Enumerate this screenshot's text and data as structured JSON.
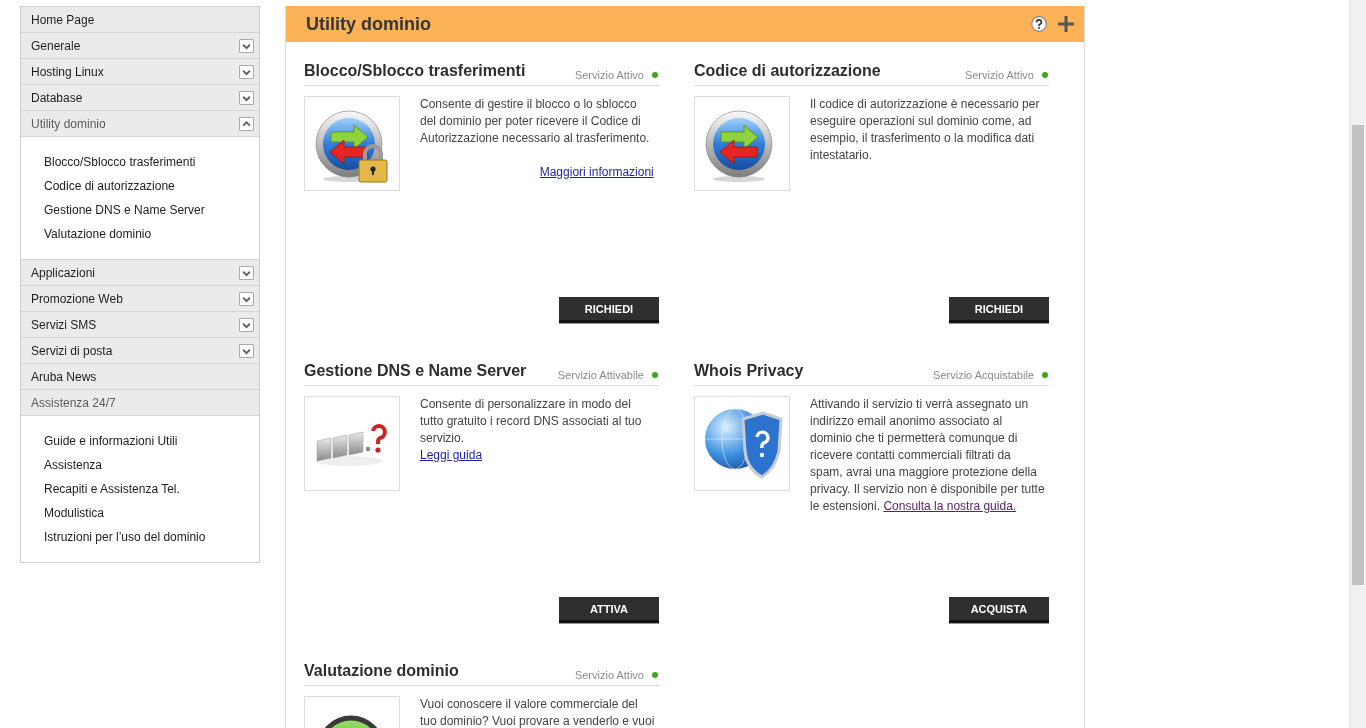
{
  "sidebar": {
    "items": [
      {
        "label": "Home Page",
        "kind": "link",
        "expanded": false
      },
      {
        "label": "Generale",
        "kind": "toggle",
        "expanded": false
      },
      {
        "label": "Hosting Linux",
        "kind": "toggle",
        "expanded": false
      },
      {
        "label": "Database",
        "kind": "toggle",
        "expanded": false
      },
      {
        "label": "Utility dominio",
        "kind": "toggle",
        "expanded": true,
        "children": [
          {
            "label": "Blocco/Sblocco trasferimenti"
          },
          {
            "label": "Codice di autorizzazione"
          },
          {
            "label": "Gestione DNS e Name Server"
          },
          {
            "label": "Valutazione dominio"
          }
        ]
      },
      {
        "label": "Applicazioni",
        "kind": "toggle",
        "expanded": false
      },
      {
        "label": "Promozione Web",
        "kind": "toggle",
        "expanded": false
      },
      {
        "label": "Servizi SMS",
        "kind": "toggle",
        "expanded": false
      },
      {
        "label": "Servizi di posta",
        "kind": "toggle",
        "expanded": false
      },
      {
        "label": "Aruba News",
        "kind": "link",
        "expanded": false
      },
      {
        "label": "Assistenza 24/7",
        "kind": "link",
        "expanded": true,
        "children": [
          {
            "label": "Guide e informazioni Utili"
          },
          {
            "label": "Assistenza"
          },
          {
            "label": "Recapiti e Assistenza Tel."
          },
          {
            "label": "Modulistica"
          },
          {
            "label": "Istruzioni per l’uso del dominio"
          }
        ]
      }
    ]
  },
  "panel": {
    "title": "Utility dominio",
    "cards": [
      {
        "title": "Blocco/Sblocco trasferimenti",
        "status": "Servizio Attivo",
        "description": "Consente di gestire il blocco o lo sblocco del dominio per poter ricevere il Codice di Autorizzazione necessario al trasferimento.",
        "link": {
          "text": "Maggiori informazioni",
          "kind": "more",
          "visited": false
        },
        "button": "RICHIEDI"
      },
      {
        "title": "Codice di autorizzazione",
        "status": "Servizio Attivo",
        "description": "Il codice di autorizzazione è necessario per eseguire operazioni sul dominio come, ad esempio, il trasferimento o la modifica dati intestatario.",
        "button": "RICHIEDI"
      },
      {
        "title": "Gestione DNS e Name Server",
        "status": "Servizio Attivabile",
        "description": "Consente di personalizzare in modo del tutto gratuito i record DNS associati al tuo servizio.",
        "link": {
          "text": "Leggi guida",
          "kind": "guide",
          "visited": false
        },
        "button": "ATTIVA"
      },
      {
        "title": "Whois Privacy",
        "status": "Servizio Acquistabile",
        "description": "Attivando il servizio ti verrà assegnato un indirizzo email anonimo associato al dominio che ti permetterà comunque di ricevere contatti commerciali filtrati da spam, avrai una maggiore protezione della privacy. Il servizio non è disponibile per tutte le estensioni.",
        "link": {
          "text": "Consulta la nostra guida.",
          "kind": "inline",
          "visited": true
        },
        "button": "ACQUISTA"
      },
      {
        "title": "Valutazione dominio",
        "status": "Servizio Attivo",
        "description": "Vuoi conoscere il valore commerciale del tuo dominio? Vuoi provare a venderlo e vuoi"
      }
    ]
  }
}
